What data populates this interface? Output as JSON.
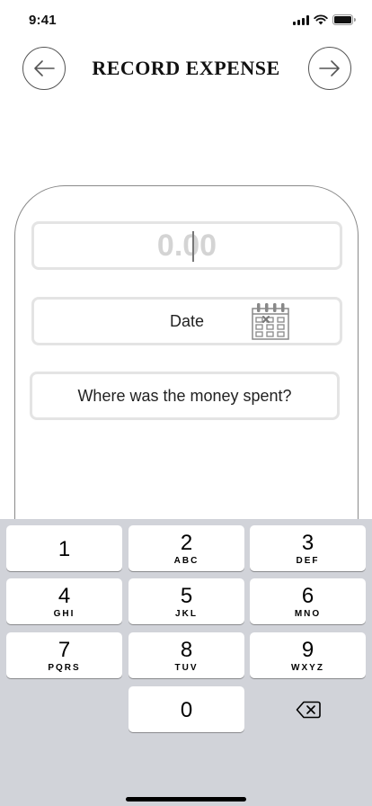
{
  "status_bar": {
    "time": "9:41"
  },
  "header": {
    "title": "RECORD EXPENSE"
  },
  "form": {
    "amount_placeholder": "0.00",
    "date_label": "Date",
    "where_placeholder": "Where was the money spent?"
  },
  "keyboard": {
    "keys": [
      {
        "digit": "1",
        "letters": ""
      },
      {
        "digit": "2",
        "letters": "ABC"
      },
      {
        "digit": "3",
        "letters": "DEF"
      },
      {
        "digit": "4",
        "letters": "GHI"
      },
      {
        "digit": "5",
        "letters": "JKL"
      },
      {
        "digit": "6",
        "letters": "MNO"
      },
      {
        "digit": "7",
        "letters": "PQRS"
      },
      {
        "digit": "8",
        "letters": "TUV"
      },
      {
        "digit": "9",
        "letters": "WXYZ"
      },
      {
        "digit": "0",
        "letters": ""
      }
    ]
  },
  "icons": {
    "back": "arrow-left-icon",
    "forward": "arrow-right-icon",
    "calendar": "calendar-icon",
    "delete": "backspace-icon"
  },
  "colors": {
    "keyboard_bg": "#d1d3d9",
    "field_border": "#e4e4e4",
    "placeholder": "#d4d4d4"
  }
}
